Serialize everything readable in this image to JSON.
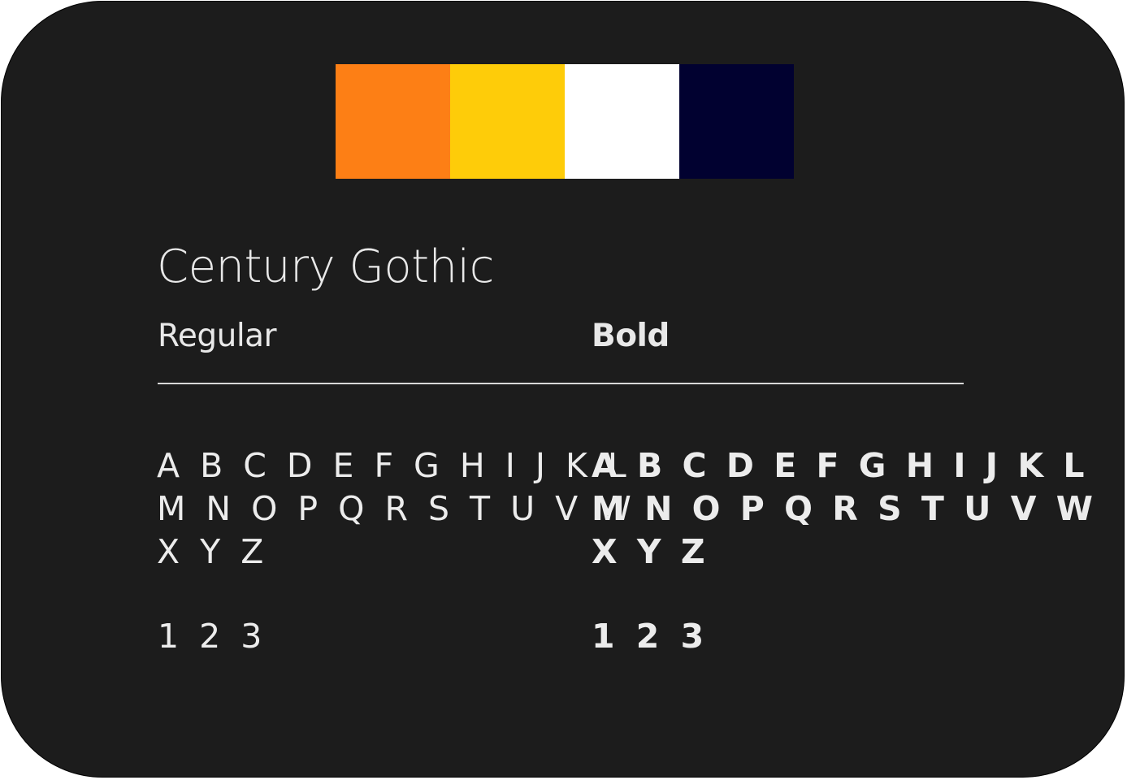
{
  "palette": {
    "swatches": [
      {
        "color": "#fd7f15"
      },
      {
        "color": "#fecc09"
      },
      {
        "color": "#ffffff"
      },
      {
        "color": "#010130"
      }
    ]
  },
  "typography": {
    "font_name": "Century Gothic",
    "regular": {
      "label": "Regular",
      "letters": [
        "A B C D E F G H I J K L",
        "M N O P Q R S T U V W",
        "X Y Z"
      ],
      "digits": "1 2 3"
    },
    "bold": {
      "label": "Bold",
      "letters": [
        "A B C D E F G H I J K L",
        "M N O P Q R S T U V W",
        "X Y Z"
      ],
      "digits": "1 2 3"
    }
  }
}
